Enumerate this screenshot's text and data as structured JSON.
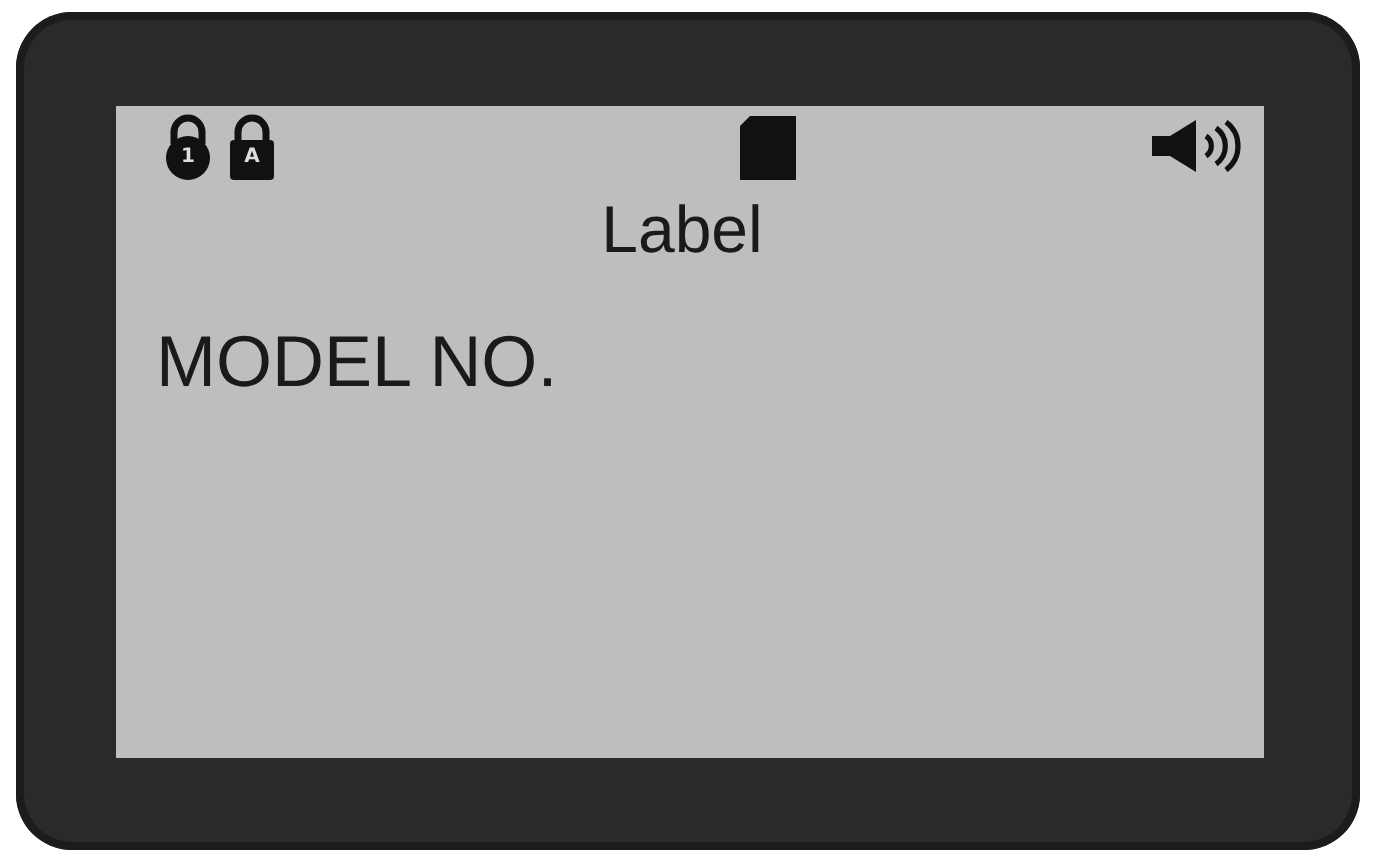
{
  "status_bar": {
    "locks": [
      {
        "kind": "round",
        "label": "1"
      },
      {
        "kind": "square",
        "label": "A"
      }
    ]
  },
  "title": "Label",
  "content": "MODEL NO."
}
